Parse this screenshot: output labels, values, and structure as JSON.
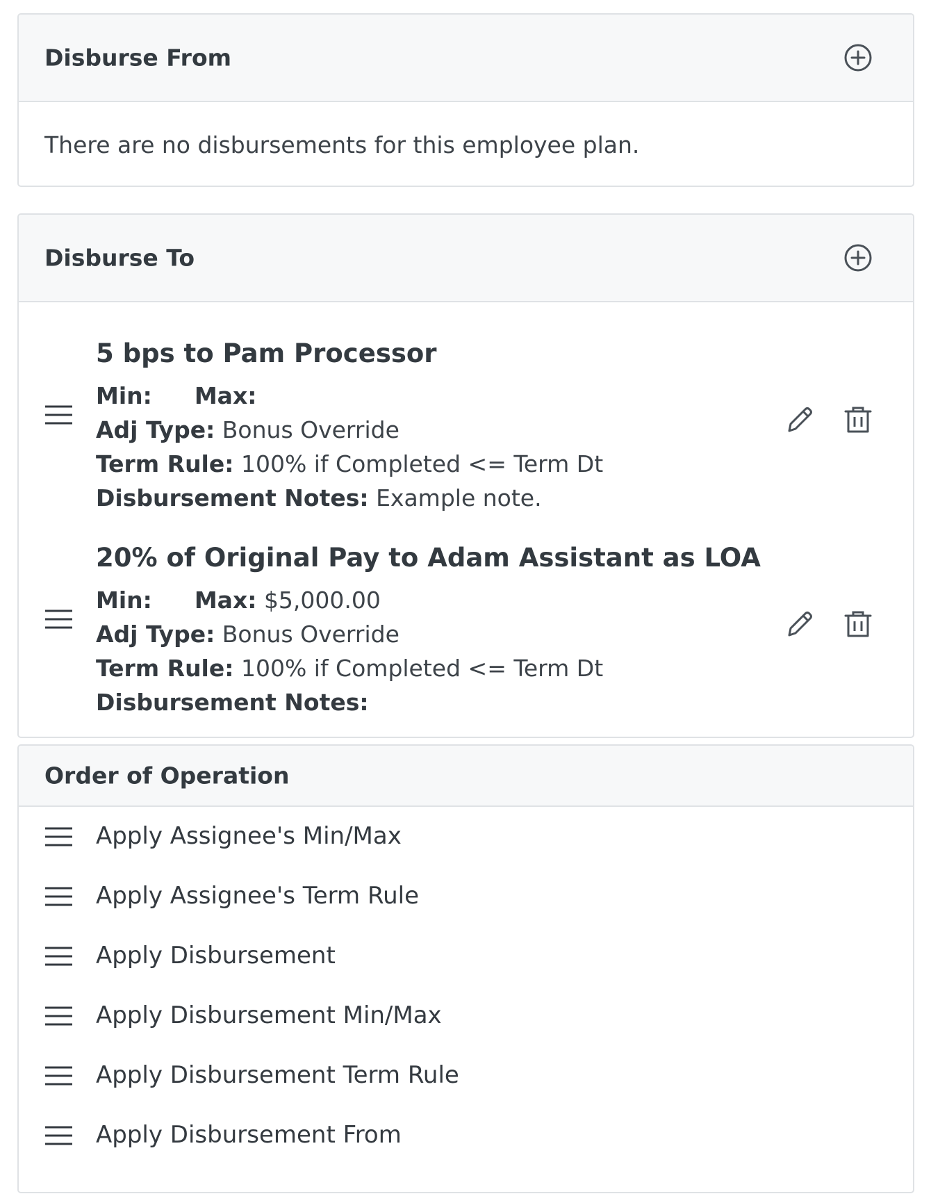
{
  "disburse_from": {
    "title": "Disburse From",
    "empty_message": "There are no disbursements for this employee plan."
  },
  "disburse_to": {
    "title": "Disburse To",
    "items": [
      {
        "title": "5 bps to Pam Processor",
        "min_label": "Min:",
        "min_value": "",
        "max_label": "Max:",
        "max_value": "",
        "adj_type_label": "Adj Type:",
        "adj_type_value": "Bonus Override",
        "term_rule_label": "Term Rule:",
        "term_rule_value": "100% if Completed <= Term Dt",
        "notes_label": "Disbursement Notes:",
        "notes_value": "Example note."
      },
      {
        "title": "20% of Original Pay to Adam Assistant as LOA",
        "min_label": "Min:",
        "min_value": "",
        "max_label": "Max:",
        "max_value": "$5,000.00",
        "adj_type_label": "Adj Type:",
        "adj_type_value": "Bonus Override",
        "term_rule_label": "Term Rule:",
        "term_rule_value": "100% if Completed <= Term Dt",
        "notes_label": "Disbursement Notes:",
        "notes_value": ""
      }
    ]
  },
  "order_of_operation": {
    "title": "Order of Operation",
    "items": [
      "Apply Assignee's Min/Max",
      "Apply Assignee's Term Rule",
      "Apply Disbursement",
      "Apply Disbursement Min/Max",
      "Apply Disbursement Term Rule",
      "Apply Disbursement From"
    ]
  },
  "icons": {
    "add": "plus-circle-icon",
    "drag": "drag-handle-icon",
    "edit": "pencil-icon",
    "delete": "trash-icon"
  },
  "colors": {
    "header_bg": "#f7f8f9",
    "border": "#dfe2e5",
    "text": "#343a40",
    "icon": "#4a5158"
  }
}
